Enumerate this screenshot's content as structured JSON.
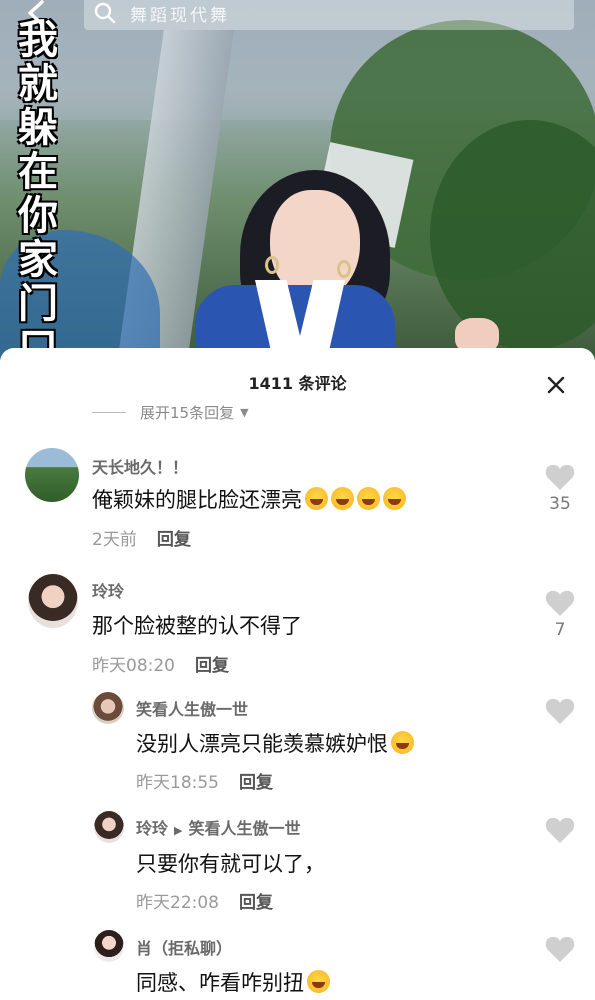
{
  "video": {
    "overlay_text": "我就躲在你家门口",
    "search_placeholder": "舞蹈现代舞"
  },
  "comments_panel": {
    "title": "1411 条评论",
    "expand_text": "展开15条回复",
    "comments": [
      {
        "user": "天长地久！！",
        "text": "俺颖妹的腿比脸还漂亮",
        "emojis": [
          "rofl-emoji",
          "rofl-emoji",
          "grin-emoji",
          "grin-emoji"
        ],
        "time": "2天前",
        "reply_label": "回复",
        "likes": "35"
      },
      {
        "user": "玲玲",
        "text": "那个脸被整的认不得了",
        "emojis": [],
        "time": "昨天08:20",
        "reply_label": "回复",
        "likes": "7"
      },
      {
        "user": "笑看人生傲一世",
        "text": "没别人漂亮只能羡慕嫉妒恨",
        "emojis": [
          "rofl-emoji"
        ],
        "time": "昨天18:55",
        "reply_label": "回复",
        "likes": ""
      },
      {
        "user": "玲玲",
        "reply_to": "笑看人生傲一世",
        "text": "只要你有就可以了，",
        "emojis": [],
        "time": "昨天22:08",
        "reply_label": "回复",
        "likes": ""
      },
      {
        "user": "肖（拒私聊）",
        "text": "同感、咋看咋别扭",
        "emojis": [
          "confused-emoji"
        ],
        "time": "",
        "reply_label": "",
        "likes": ""
      }
    ]
  },
  "colors": {
    "username": "#6a6a6a",
    "meta": "#9a9a9a",
    "like_icon": "#cfcfcf"
  }
}
